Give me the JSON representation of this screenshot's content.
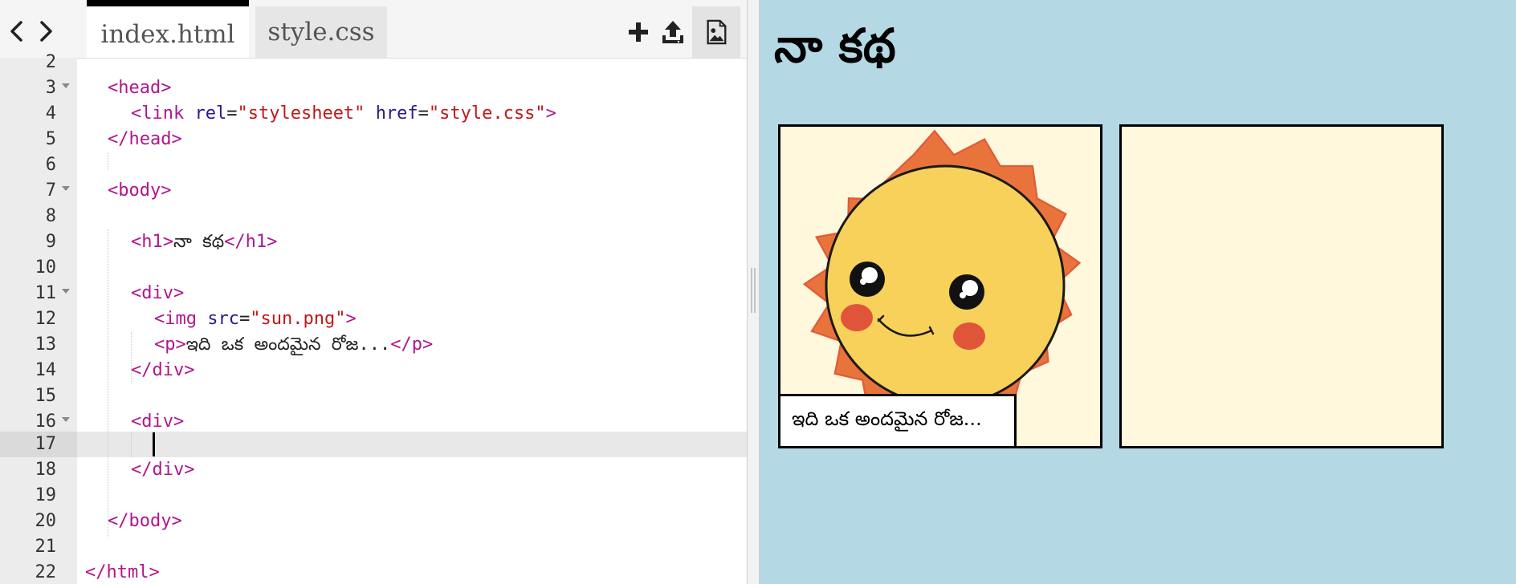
{
  "tabs": [
    {
      "label": "index.html",
      "active": true
    },
    {
      "label": "style.css",
      "active": false
    }
  ],
  "icons": {
    "back": "chevron-left-icon",
    "forward": "chevron-right-icon",
    "add": "plus-icon",
    "upload": "upload-icon",
    "image": "image-icon"
  },
  "editor": {
    "line_numbers": [
      "2",
      "3",
      "4",
      "5",
      "6",
      "7",
      "8",
      "9",
      "10",
      "11",
      "12",
      "13",
      "14",
      "15",
      "16",
      "17",
      "18",
      "19",
      "20",
      "21",
      "22"
    ],
    "active_line": "17",
    "code": {
      "l3_open": "<head>",
      "l4_link": "<link",
      "l4_rel_attr": "rel",
      "l4_rel_val": "\"stylesheet\"",
      "l4_href_attr": "href",
      "l4_href_val": "\"style.css\"",
      "l4_close": ">",
      "l5_close": "</head>",
      "l7_open": "<body>",
      "l9_open": "<h1>",
      "l9_text": "నా కథ",
      "l9_close": "</h1>",
      "l11_open": "<div>",
      "l12_img": "<img",
      "l12_src_attr": "src",
      "l12_src_val": "\"sun.png\"",
      "l12_close": ">",
      "l13_open": "<p>",
      "l13_text": "ఇది ఒక అందమైన రోజ...",
      "l13_close": "</p>",
      "l14_close": "</div>",
      "l16_open": "<div>",
      "l18_close": "</div>",
      "l20_close": "</body>",
      "l22_close": "</html>",
      "eq": "="
    }
  },
  "preview": {
    "title": "నా కథ",
    "panels": [
      {
        "image": "sun",
        "caption": "ఇది ఒక అందమైన రోజ..."
      },
      {
        "image": null,
        "caption": null
      }
    ]
  },
  "colors": {
    "preview_bg": "#b5d8e5",
    "panel_bg": "#fff8dc",
    "tag": "#b0168c",
    "attr": "#2a1b8a",
    "string": "#c01818",
    "sun_rays": "#e8743b",
    "sun_face": "#f7d15a",
    "cheeks": "#e0553a"
  }
}
